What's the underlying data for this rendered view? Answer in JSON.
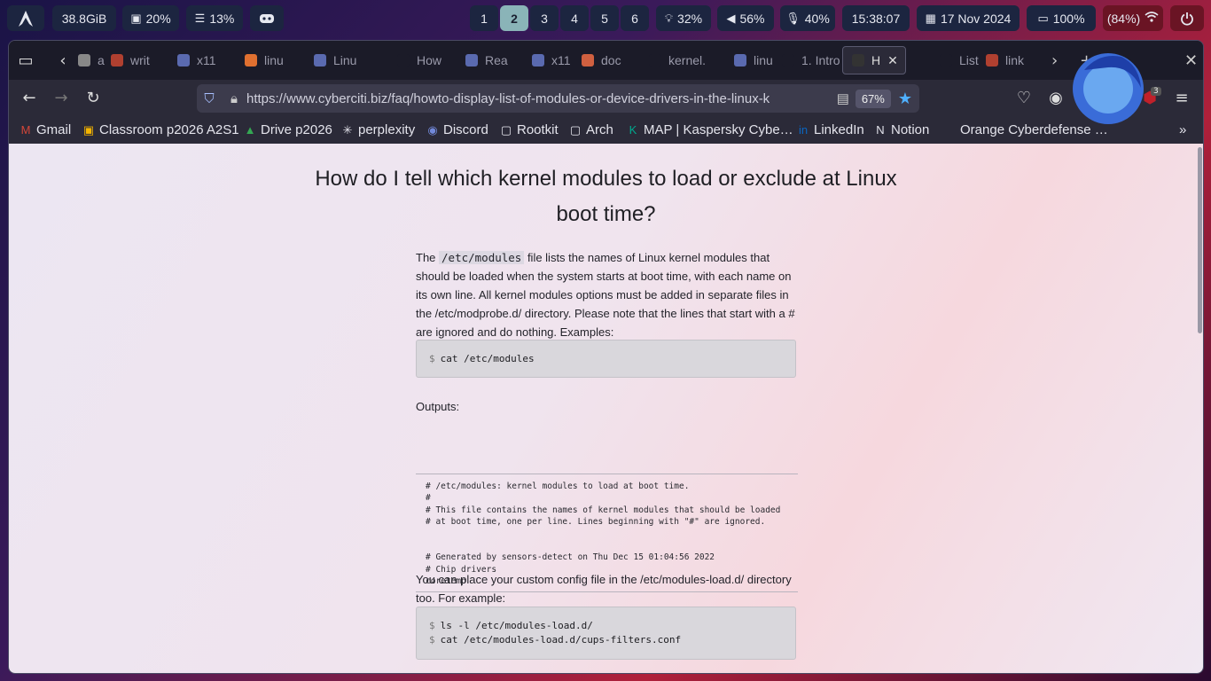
{
  "topbar": {
    "memory": "38.8GiB",
    "cpu": "20%",
    "load": "13%",
    "workspaces": [
      "1",
      "2",
      "3",
      "4",
      "5",
      "6"
    ],
    "active_workspace": "2",
    "brightness": "32%",
    "volume": "56%",
    "mic": "40%",
    "time": "15:38:07",
    "date": "17 Nov 2024",
    "battery": "100%",
    "wifi": "(84%)"
  },
  "browser": {
    "tabs": [
      {
        "label": "a",
        "fav_color": "#888888"
      },
      {
        "label": "writ",
        "fav_color": "#b04030"
      },
      {
        "label": "x11",
        "fav_color": "#5a6ab0"
      },
      {
        "label": "linu",
        "fav_color": "#e07030"
      },
      {
        "label": "Linu",
        "fav_color": "#5a6ab0"
      },
      {
        "label": "How",
        "fav_color": "#1b1b28"
      },
      {
        "label": "Rea",
        "fav_color": "#5a6ab0"
      },
      {
        "label": "x11",
        "fav_color": "#5a6ab0"
      },
      {
        "label": "doc",
        "fav_color": "#d06040"
      },
      {
        "label": "kernel.",
        "fav_color": "#1b1b28"
      },
      {
        "label": "linu",
        "fav_color": "#5a6ab0"
      },
      {
        "label": "1. Intro",
        "fav_color": "#1b1b28"
      },
      {
        "label": "H",
        "fav_color": "#333333"
      },
      {
        "label": "List",
        "fav_color": "#1b1b28"
      },
      {
        "label": "link",
        "fav_color": "#b04030"
      }
    ],
    "url": "https://www.cyberciti.biz/faq/howto-display-list-of-modules-or-device-drivers-in-the-linux-k",
    "zoom": "67%",
    "extension_badge": "3",
    "bookmarks": [
      {
        "label": "Gmail",
        "icon": "gmail-icon"
      },
      {
        "label": "Classroom p2026 A2S1",
        "icon": "classroom-icon"
      },
      {
        "label": "Drive p2026",
        "icon": "drive-icon"
      },
      {
        "label": "perplexity",
        "icon": "perplexity-icon"
      },
      {
        "label": "Discord",
        "icon": "discord-icon"
      },
      {
        "label": "Rootkit",
        "icon": "folder-icon"
      },
      {
        "label": "Arch",
        "icon": "folder-icon"
      },
      {
        "label": "MAP | Kaspersky Cybe…",
        "icon": "kaspersky-icon"
      },
      {
        "label": "LinkedIn",
        "icon": "linkedin-icon"
      },
      {
        "label": "Notion",
        "icon": "notion-icon"
      },
      {
        "label": "Orange Cyberdefense …",
        "icon": ""
      }
    ]
  },
  "article": {
    "title_line1": "How do I tell which kernel modules to load or exclude at Linux",
    "title_line2": "boot time?",
    "intro_pre": "The ",
    "intro_code": "/etc/modules",
    "intro_post": " file lists the names of Linux kernel modules that should be loaded when the system starts at boot time, with each name on its own line. All kernel modules options must be added in separate files in the /etc/modprobe.d/ directory. Please note that the lines that start with a # are ignored and do nothing. Examples:",
    "cmd1": "cat /etc/modules",
    "outputs_label": "Outputs:",
    "output_lines": [
      "# /etc/modules: kernel modules to load at boot time.",
      "#",
      "# This file contains the names of kernel modules that should be loaded",
      "# at boot time, one per line. Lines beginning with \"#\" are ignored.",
      "",
      "",
      "# Generated by sensors-detect on Thu Dec 15 01:04:56 2022",
      "# Chip drivers",
      "coretemp"
    ],
    "para2": "You can place your custom config file in the /etc/modules-load.d/ directory too. For example:",
    "cmd2": [
      "ls -l /etc/modules-load.d/",
      "cat /etc/modules-load.d/cups-filters.conf"
    ],
    "prompt": "$"
  }
}
